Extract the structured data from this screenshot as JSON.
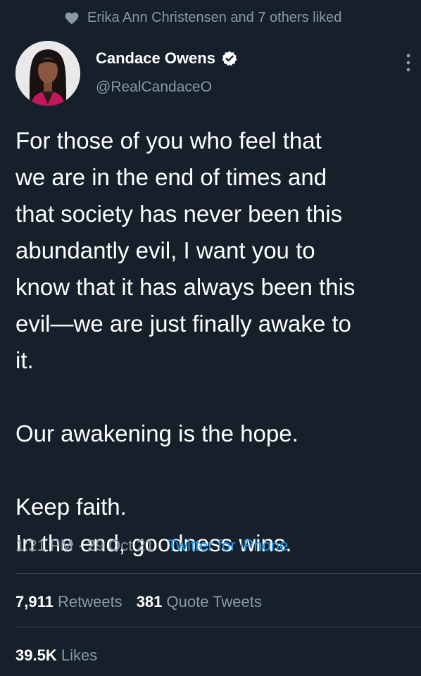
{
  "social_context": {
    "icon": "heart-icon",
    "text": "Erika Ann Christensen and 7 others liked"
  },
  "author": {
    "name": "Candace Owens",
    "handle": "@RealCandaceO",
    "verified_icon": "verified-badge-icon"
  },
  "tweet": {
    "paragraphs": [
      "For those of you who feel that we are in the end of times and that society has never been this abundantly evil, I want you to know that it has always been this evil—we are just finally awake to it.",
      "Our awakening is the hope.",
      "Keep faith.\nIn the end, goodness wins."
    ],
    "lines": {
      "p1_l1": "For those of you who feel that",
      "p1_l2": "we are in the end of times and",
      "p1_l3": "that society has never been this",
      "p1_l4": "abundantly evil, I want you to",
      "p1_l5": "know that it has always been this",
      "p1_l6": "evil—we are just finally awake to",
      "p1_l7": "it.",
      "p2_l1": "Our awakening is the hope.",
      "p3_l1": "Keep faith.",
      "p3_l2": "In the end, goodness wins."
    }
  },
  "meta": {
    "time": "1:21 PM",
    "separator": "·",
    "date": "29 Oct 21",
    "source": "Twitter for iPhone"
  },
  "stats": {
    "retweets_count": "7,911",
    "retweets_label": "Retweets",
    "quotes_count": "381",
    "quotes_label": "Quote Tweets",
    "likes_count": "39.5K",
    "likes_label": "Likes"
  },
  "colors": {
    "background": "#15202b",
    "text_primary": "#ffffff",
    "text_secondary": "#8b98a5",
    "link": "#1d9bf0",
    "divider": "#38444d"
  }
}
